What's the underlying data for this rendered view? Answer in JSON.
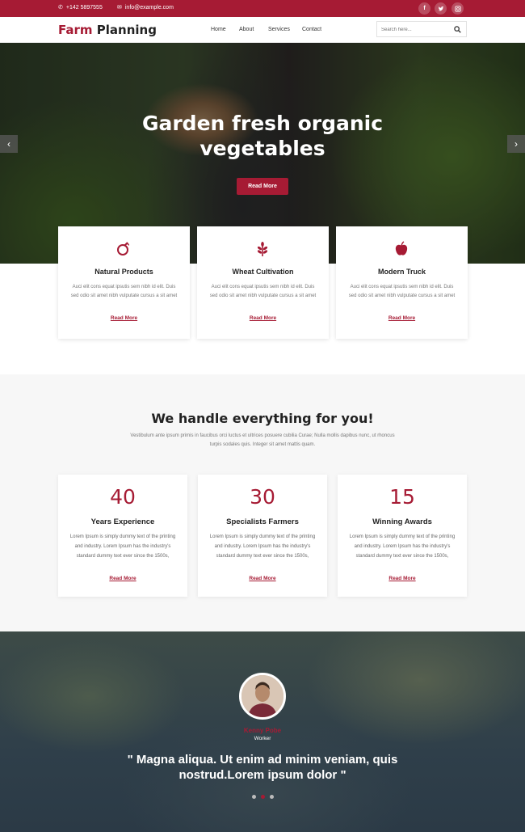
{
  "topbar": {
    "phone": "+142 5897555",
    "email": "info@example.com",
    "social": [
      "facebook-icon",
      "twitter-icon",
      "instagram-icon"
    ]
  },
  "nav": {
    "logo_accent": "Farm",
    "logo_rest": "Planning",
    "links": [
      "Home",
      "About",
      "Services",
      "Contact"
    ],
    "search_placeholder": "Search here..."
  },
  "hero": {
    "title": "Garden fresh organic vegetables",
    "button": "Read More"
  },
  "features": [
    {
      "icon": "fruit-icon",
      "title": "Natural Products",
      "text": "Auci elit cons equat ipsutis sem nibh id elit. Duis sed odio sit amet nibh vulputate cursus a sit amet",
      "link": "Read More"
    },
    {
      "icon": "wheat-icon",
      "title": "Wheat Cultivation",
      "text": "Auci elit cons equat ipsutis sem nibh id elit. Duis sed odio sit amet nibh vulputate cursus a sit amet",
      "link": "Read More"
    },
    {
      "icon": "apple-icon",
      "title": "Modern Truck",
      "text": "Auci elit cons equat ipsutis sem nibh id elit. Duis sed odio sit amet nibh vulputate cursus a sit amet",
      "link": "Read More"
    }
  ],
  "about": {
    "title": "We handle everything for you!",
    "subtitle": "Vestibulum ante ipsum primis in faucibus orci luctus et ultrices posuere cubilia Curae; Nulla mollis dapibus nunc, ut rhoncus turpis sodales quis. Integer sit amet mattis quam."
  },
  "stats": [
    {
      "number": "40",
      "title": "Years Experience",
      "text": "Lorem Ipsum is simply dummy text of the printing and industry. Lorem Ipsum has the industry's standard dummy text ever since the 1500s,",
      "link": "Read More"
    },
    {
      "number": "30",
      "title": "Specialists Farmers",
      "text": "Lorem Ipsum is simply dummy text of the printing and industry. Lorem Ipsum has the industry's standard dummy text ever since the 1500s,",
      "link": "Read More"
    },
    {
      "number": "15",
      "title": "Winning Awards",
      "text": "Lorem Ipsum is simply dummy text of the printing and industry. Lorem Ipsum has the industry's standard dummy text ever since the 1500s,",
      "link": "Read More"
    }
  ],
  "testimonial": {
    "name": "Kenny Pobe",
    "role": "Worker",
    "quote": "\" Magna aliqua. Ut enim ad minim veniam, quis nostrud.Lorem ipsum dolor \"",
    "active_slide": 2,
    "slides": 3
  },
  "colors": {
    "brand": "#a61b34"
  }
}
